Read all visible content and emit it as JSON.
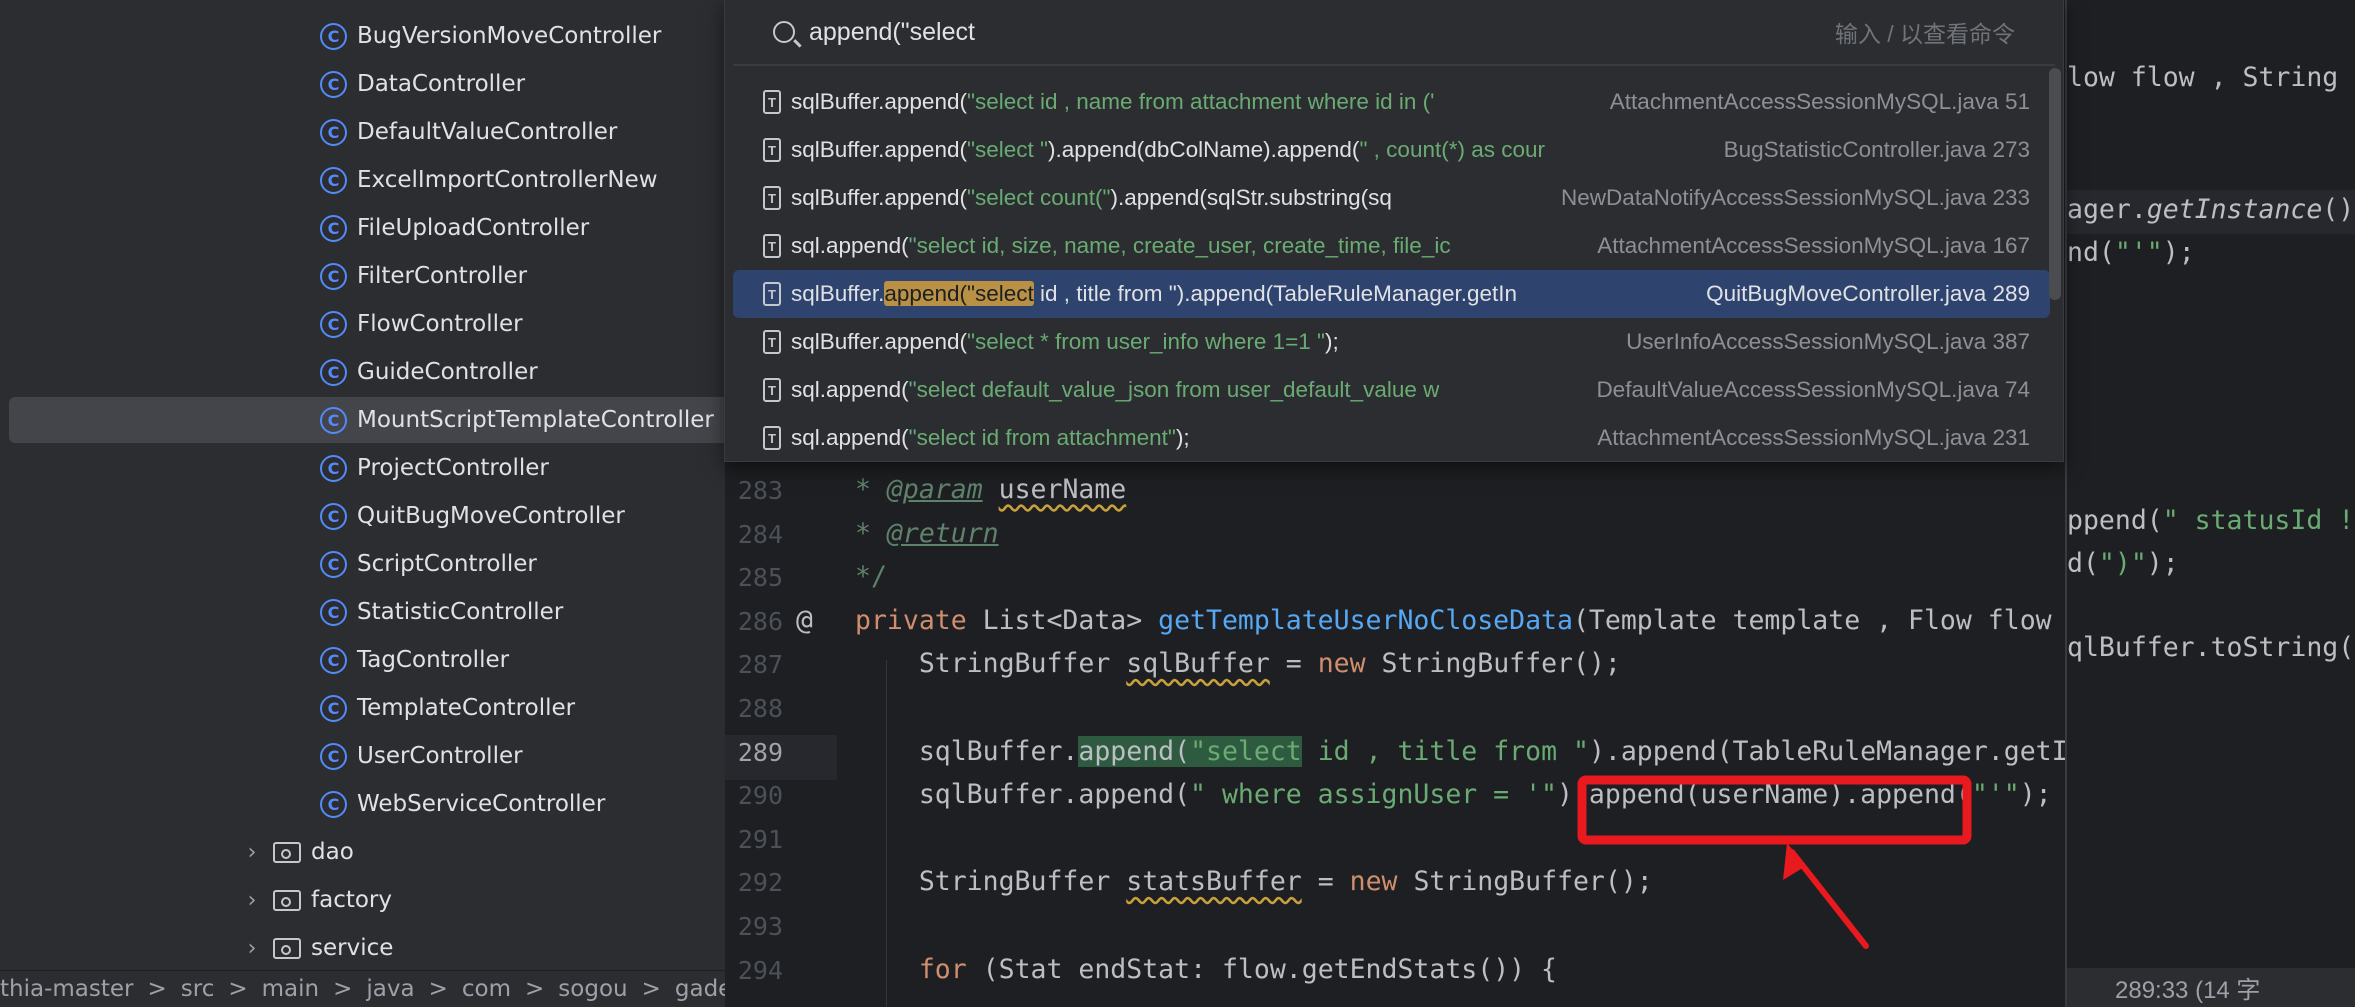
{
  "sidebar": {
    "items": [
      {
        "label": "BugVersionMoveController",
        "type": "class"
      },
      {
        "label": "DataController",
        "type": "class"
      },
      {
        "label": "DefaultValueController",
        "type": "class"
      },
      {
        "label": "ExcelImportControllerNew",
        "type": "class"
      },
      {
        "label": "FileUploadController",
        "type": "class"
      },
      {
        "label": "FilterController",
        "type": "class"
      },
      {
        "label": "FlowController",
        "type": "class"
      },
      {
        "label": "GuideController",
        "type": "class"
      },
      {
        "label": "MountScriptTemplateController",
        "type": "class",
        "selected": true
      },
      {
        "label": "ProjectController",
        "type": "class"
      },
      {
        "label": "QuitBugMoveController",
        "type": "class"
      },
      {
        "label": "ScriptController",
        "type": "class"
      },
      {
        "label": "StatisticController",
        "type": "class"
      },
      {
        "label": "TagController",
        "type": "class"
      },
      {
        "label": "TemplateController",
        "type": "class"
      },
      {
        "label": "UserController",
        "type": "class"
      },
      {
        "label": "WebServiceController",
        "type": "class"
      },
      {
        "label": "dao",
        "type": "folder"
      },
      {
        "label": "factory",
        "type": "folder"
      },
      {
        "label": "service",
        "type": "folder"
      }
    ],
    "class_icon": "C"
  },
  "breadcrumb": [
    "thia-master",
    "src",
    "main",
    "java",
    "com",
    "sogou",
    "gade"
  ],
  "search": {
    "query": "append(\"select",
    "hint": "输入 / 以查看命令",
    "result_icon": "T",
    "results": [
      {
        "code": [
          [
            "",
            "sqlBuffer.append("
          ],
          [
            "s",
            "\"select id , name from attachment where id in ('"
          ]
        ],
        "file": "AttachmentAccessSessionMySQL.java 51"
      },
      {
        "code": [
          [
            "",
            "sqlBuffer.append("
          ],
          [
            "s",
            "\"select \""
          ],
          [
            "",
            ").append(dbColName).append("
          ],
          [
            "s",
            "\" , count(*) as cour"
          ]
        ],
        "file": "BugStatisticController.java 273"
      },
      {
        "code": [
          [
            "",
            "sqlBuffer.append("
          ],
          [
            "s",
            "\"select count(\""
          ],
          [
            "",
            ").append(sqlStr.substring(sq"
          ]
        ],
        "file": "NewDataNotifyAccessSessionMySQL.java 233"
      },
      {
        "code": [
          [
            "",
            "sql.append("
          ],
          [
            "s",
            "\"select id, size, name, create_user, create_time, file_ic"
          ]
        ],
        "file": "AttachmentAccessSessionMySQL.java 167"
      },
      {
        "code": [
          [
            "",
            "sqlBuffer."
          ],
          [
            "mh",
            "append(\"select"
          ],
          [
            "",
            " id , title from \").append(TableRuleManager.getIn"
          ]
        ],
        "file": "QuitBugMoveController.java 289",
        "selected": true
      },
      {
        "code": [
          [
            "",
            "sqlBuffer.append("
          ],
          [
            "s",
            "\"select * from user_info where 1=1 \""
          ],
          [
            "",
            ");"
          ]
        ],
        "file": "UserInfoAccessSessionMySQL.java 387"
      },
      {
        "code": [
          [
            "",
            "sql.append("
          ],
          [
            "s",
            "\"select default_value_json from user_default_value w"
          ]
        ],
        "file": "DefaultValueAccessSessionMySQL.java 74"
      },
      {
        "code": [
          [
            "",
            "sql.append("
          ],
          [
            "s",
            "\"select id from attachment\""
          ],
          [
            "",
            ");"
          ]
        ],
        "file": "AttachmentAccessSessionMySQL.java 231"
      }
    ]
  },
  "editor": {
    "current_line": "289",
    "override_icon": "@",
    "lines": [
      {
        "n": "283",
        "code": [
          [
            "cm",
            "* "
          ],
          [
            "tag",
            "@param"
          ],
          [
            "cm",
            " "
          ],
          [
            "sq",
            "userName"
          ]
        ]
      },
      {
        "n": "284",
        "code": [
          [
            "cm",
            "* "
          ],
          [
            "tag",
            "@return"
          ]
        ]
      },
      {
        "n": "285",
        "code": [
          [
            "cm",
            "*/"
          ]
        ]
      },
      {
        "n": "286",
        "code": [
          [
            "k",
            "private "
          ],
          [
            "",
            "List<Data> "
          ],
          [
            "m",
            "getTemplateUserNoCloseData"
          ],
          [
            "",
            "(Template template , Flow flow"
          ]
        ]
      },
      {
        "n": "287",
        "code": [
          [
            "",
            "    StringBuffer "
          ],
          [
            "sq",
            "sqlBuffer"
          ],
          [
            "",
            " = "
          ],
          [
            "k",
            "new "
          ],
          [
            "",
            "StringBuffer();"
          ]
        ]
      },
      {
        "n": "288",
        "code": []
      },
      {
        "n": "289",
        "code": [
          [
            "",
            "    sqlBuffer."
          ],
          [
            "hl",
            "append("
          ],
          [
            "hl s",
            "\"select"
          ],
          [
            "s",
            " id , title from \""
          ],
          [
            "",
            ").append(TableRuleManager.getI"
          ]
        ]
      },
      {
        "n": "290",
        "code": [
          [
            "",
            "    sqlBuffer.append("
          ],
          [
            "s",
            "\" where assignUser = '\""
          ],
          [
            "",
            ").append(userName).append("
          ],
          [
            "s",
            "\"'\""
          ],
          [
            "",
            ");"
          ]
        ]
      },
      {
        "n": "291",
        "code": []
      },
      {
        "n": "292",
        "code": [
          [
            "",
            "    StringBuffer "
          ],
          [
            "sq",
            "statsBuffer"
          ],
          [
            "",
            " = "
          ],
          [
            "k",
            "new "
          ],
          [
            "",
            "StringBuffer();"
          ]
        ]
      },
      {
        "n": "293",
        "code": []
      },
      {
        "n": "294",
        "code": [
          [
            "",
            "    "
          ],
          [
            "k",
            "for "
          ],
          [
            "",
            "(Stat endStat: flow.getEndStats()) {"
          ]
        ]
      }
    ]
  },
  "right_pane": {
    "lines": [
      {
        "code": [
          [
            "",
            "low flow , String u"
          ]
        ]
      },
      {
        "code": [
          [
            "",
            "ager."
          ],
          [
            "it",
            "getInstance"
          ],
          [
            "",
            "()"
          ]
        ],
        "current": true
      },
      {
        "code": [
          [
            "",
            "nd("
          ],
          [
            "s",
            "\"'\""
          ],
          [
            "",
            ");"
          ]
        ]
      },
      {
        "code": [
          [
            "",
            "ppend("
          ],
          [
            "s",
            "\" statusId !="
          ]
        ]
      },
      {
        "code": [
          [
            "",
            "d("
          ],
          [
            "s",
            "\")\""
          ],
          [
            "",
            ");"
          ]
        ]
      },
      {
        "code": [
          [
            "",
            "qlBuffer.toString()"
          ]
        ]
      }
    ],
    "status": "289:33 (14 字"
  },
  "colors": {
    "keyword": "#cf8e6d",
    "string": "#6aab73",
    "method": "#56a8f5",
    "annotation_box": "#e8191f",
    "selection": "#2e436e",
    "match": "#b89145"
  }
}
